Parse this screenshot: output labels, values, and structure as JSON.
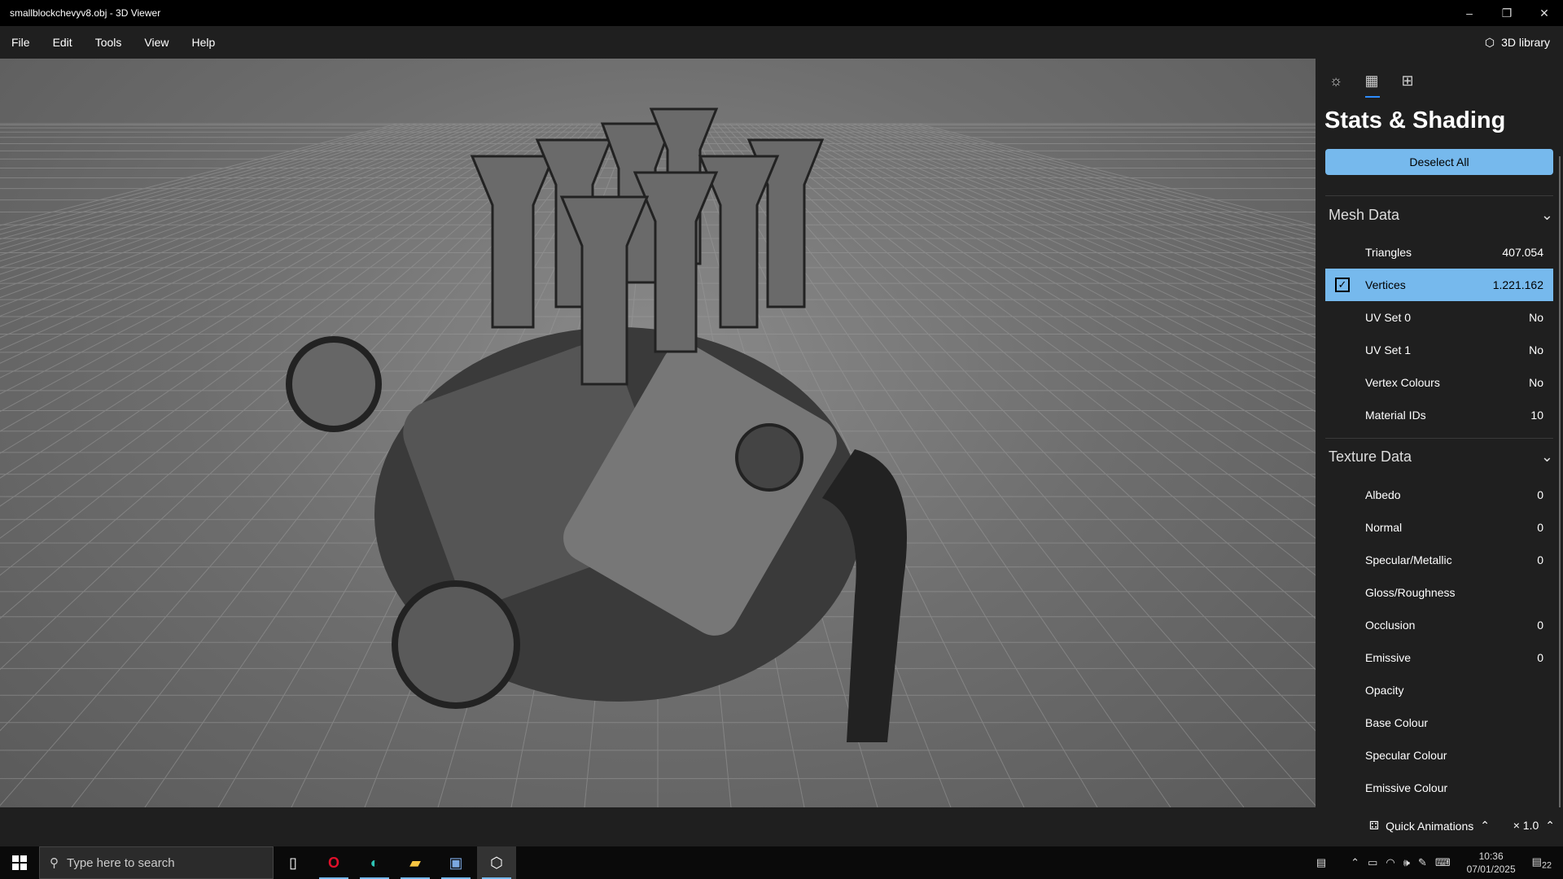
{
  "window": {
    "title": "smallblockchevyv8.obj - 3D Viewer",
    "minimize": "–",
    "restore": "❐",
    "close": "✕"
  },
  "menu": {
    "items": [
      "File",
      "Edit",
      "Tools",
      "View",
      "Help"
    ],
    "library": "3D library"
  },
  "panel": {
    "title": "Stats & Shading",
    "deselect": "Deselect All",
    "mesh": {
      "header": "Mesh Data",
      "rows": [
        {
          "label": "Triangles",
          "value": "407.054",
          "selected": false
        },
        {
          "label": "Vertices",
          "value": "1.221.162",
          "selected": true
        },
        {
          "label": "UV Set 0",
          "value": "No"
        },
        {
          "label": "UV Set 1",
          "value": "No"
        },
        {
          "label": "Vertex Colours",
          "value": "No"
        },
        {
          "label": "Material IDs",
          "value": "10"
        }
      ]
    },
    "texture": {
      "header": "Texture Data",
      "rows": [
        {
          "label": "Albedo",
          "value": "0"
        },
        {
          "label": "Normal",
          "value": "0"
        },
        {
          "label": "Specular/Metallic",
          "value": "0"
        },
        {
          "label": "Gloss/Roughness",
          "value": ""
        },
        {
          "label": "Occlusion",
          "value": "0"
        },
        {
          "label": "Emissive",
          "value": "0"
        },
        {
          "label": "Opacity",
          "value": ""
        },
        {
          "label": "Base Colour",
          "value": ""
        },
        {
          "label": "Specular Colour",
          "value": ""
        },
        {
          "label": "Emissive Colour",
          "value": ""
        }
      ]
    }
  },
  "bottom": {
    "quick_animations": "Quick Animations",
    "speed": "× 1.0"
  },
  "taskbar": {
    "search_placeholder": "Type here to search",
    "time": "10:36",
    "date": "07/01/2025",
    "notifications": "22"
  }
}
